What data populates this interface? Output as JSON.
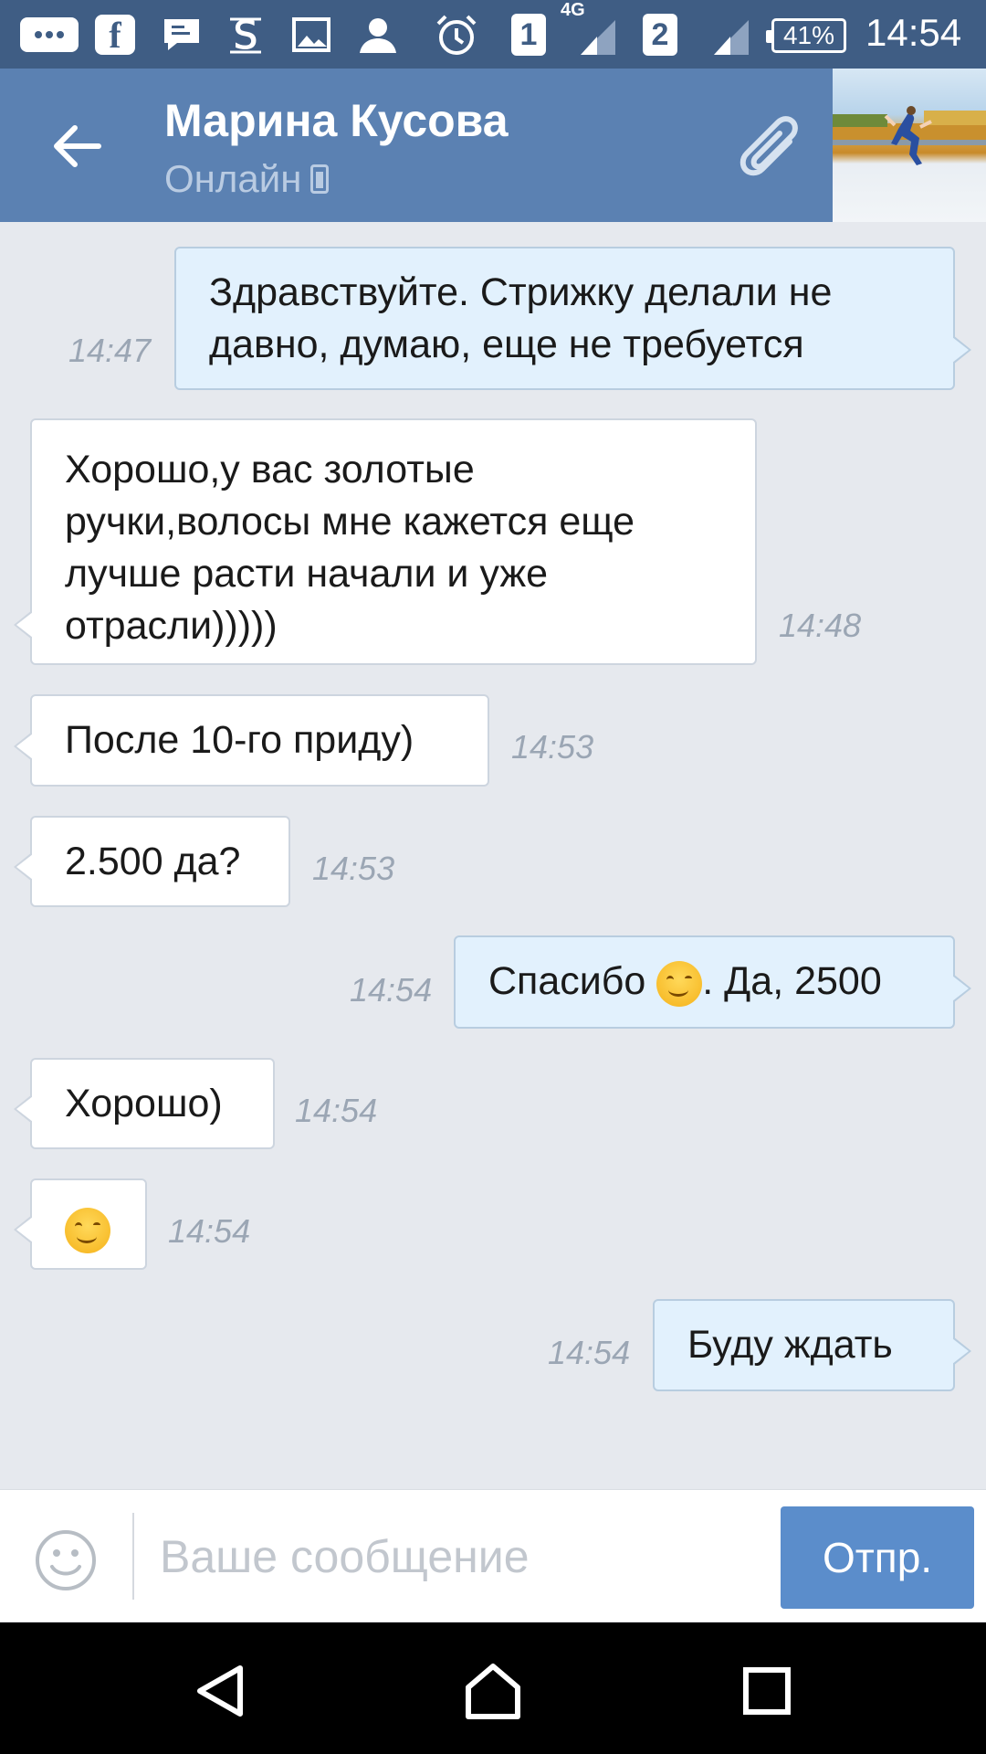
{
  "status_bar": {
    "icons": [
      "message-icon",
      "facebook-icon",
      "chat-icon",
      "s-app-icon",
      "gallery-icon",
      "person-icon",
      "alarm-icon"
    ],
    "sim1": "1",
    "sim2": "2",
    "network": "4G",
    "battery": "41%",
    "time": "14:54"
  },
  "header": {
    "contact_name": "Марина Кусова",
    "status": "Онлайн"
  },
  "messages": [
    {
      "direction": "out",
      "lines": [
        "Здравствуйте. Стрижку делали не",
        "давно, думаю, еще не требуется"
      ],
      "time": "14:47"
    },
    {
      "direction": "in",
      "lines": [
        "Хорошо,у вас золотые",
        "ручки,волосы мне кажется еще",
        "лучше расти начали и уже",
        "отрасли)))))"
      ],
      "time": "14:48"
    },
    {
      "direction": "in",
      "lines": [
        "После 10-го приду)"
      ],
      "time": "14:53"
    },
    {
      "direction": "in",
      "lines": [
        "2.500 да?"
      ],
      "time": "14:53"
    },
    {
      "direction": "out",
      "text_before": "Спасибо",
      "text_after": ". Да, 2500",
      "time": "14:54"
    },
    {
      "direction": "in",
      "lines": [
        "Хорошо)"
      ],
      "time": "14:54"
    },
    {
      "direction": "in",
      "emoji": "smiling-face-emoji",
      "time": "14:54"
    },
    {
      "direction": "out",
      "lines": [
        "Буду ждать"
      ],
      "time": "14:54"
    }
  ],
  "input": {
    "placeholder": "Ваше сообщение",
    "value": "",
    "send_label": "Отпр."
  },
  "colors": {
    "status_bar": "#3f5d84",
    "header": "#5b81b2",
    "chat_bg": "#e6e9ee",
    "outgoing_bubble": "#e2f1fd",
    "incoming_bubble": "#ffffff",
    "send_button": "#5b8dcb"
  }
}
